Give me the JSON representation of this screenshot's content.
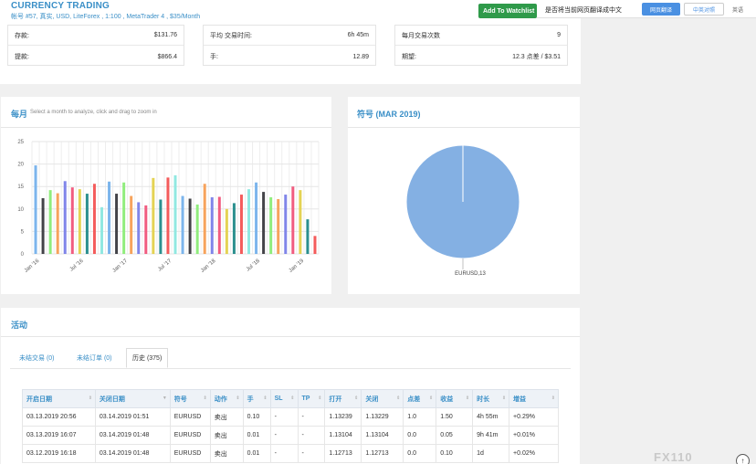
{
  "header": {
    "title": "CURRENCY TRADING",
    "subtitle": "帐号 #57, 真实, USD, LiteForex , 1:100 , MetaTrader 4 , $35/Month",
    "watchlist_button": "Add To Watchlist"
  },
  "translate_bar": {
    "prompt": "是否将当前网页翻译成中文",
    "translate_button": "网页翻译",
    "never_button": "中英对照",
    "language": "英语"
  },
  "stats": [
    {
      "rows": [
        {
          "label": "存款:",
          "value": "$131.76"
        },
        {
          "label": "提款:",
          "value": "$866.4"
        }
      ]
    },
    {
      "rows": [
        {
          "label": "平均 交易时间:",
          "value": "6h 45m"
        },
        {
          "label": "手:",
          "value": "12.89"
        }
      ]
    },
    {
      "rows": [
        {
          "label": "每月交易次数",
          "value": "9"
        },
        {
          "label": "期望:",
          "value": "12.3 点差 / $3.51"
        }
      ]
    }
  ],
  "monthly": {
    "title": "每月",
    "hint": "Select a month to analyze, click and drag to zoom in"
  },
  "symbol_panel": {
    "title": "符号 (MAR 2019)"
  },
  "chart_data": [
    {
      "type": "bar",
      "title": "每月",
      "ylim": [
        0,
        25
      ],
      "yticks": [
        0,
        5,
        10,
        15,
        20,
        25
      ],
      "xtick_labels": [
        "Jan '16",
        "Jul '16",
        "Jan '17",
        "Jul '17",
        "Jan '18",
        "Jul '18",
        "Jan '19"
      ],
      "grid": true,
      "values": [
        19.7,
        12.4,
        14.2,
        13.5,
        16.2,
        14.8,
        14.4,
        13.4,
        15.6,
        10.4,
        16.1,
        13.4,
        15.9,
        12.9,
        11.5,
        10.8,
        16.9,
        12.1,
        17.0,
        17.5,
        12.9,
        12.3,
        11.0,
        15.6,
        12.6,
        12.7,
        10.0,
        11.3,
        13.2,
        14.4,
        15.9,
        13.8,
        12.6,
        12.2,
        13.2,
        15.0,
        14.2,
        7.7,
        4.0
      ],
      "colors": [
        "#7cb5ec",
        "#434348",
        "#90ed7d",
        "#f7a35c",
        "#8085e9",
        "#f15c80",
        "#e4d354",
        "#2b908f",
        "#f45b5b",
        "#91e8e1"
      ]
    },
    {
      "type": "pie",
      "title": "符号 (MAR 2019)",
      "slices": [
        {
          "label": "EURUSD",
          "value": 13,
          "color": "#84b0e3"
        }
      ],
      "slice_label": "EURUSD,13"
    }
  ],
  "activity": {
    "title": "活动",
    "tabs": [
      "未结交易 (0)",
      "未结订单 (0)",
      "历史 (375)"
    ],
    "columns": [
      "开启日期",
      "关闭日期",
      "符号",
      "动作",
      "手",
      "SL",
      "TP",
      "打开",
      "关闭",
      "点差",
      "收益",
      "时长",
      "增益"
    ],
    "rows": [
      [
        "03.13.2019 20:56",
        "03.14.2019 01:51",
        "EURUSD",
        "卖出",
        "0.10",
        "-",
        "-",
        "1.13239",
        "1.13229",
        "1.0",
        "1.50",
        "4h 55m",
        "+0.29%"
      ],
      [
        "03.13.2019 16:07",
        "03.14.2019 01:48",
        "EURUSD",
        "卖出",
        "0.01",
        "-",
        "-",
        "1.13104",
        "1.13104",
        "0.0",
        "0.05",
        "9h 41m",
        "+0.01%"
      ],
      [
        "03.12.2019 16:18",
        "03.14.2019 01:48",
        "EURUSD",
        "卖出",
        "0.01",
        "-",
        "-",
        "1.12713",
        "1.12713",
        "0.0",
        "0.10",
        "1d",
        "+0.02%"
      ]
    ]
  },
  "watermark": "FX110",
  "scroll_top_icon": "arrow-up-icon"
}
